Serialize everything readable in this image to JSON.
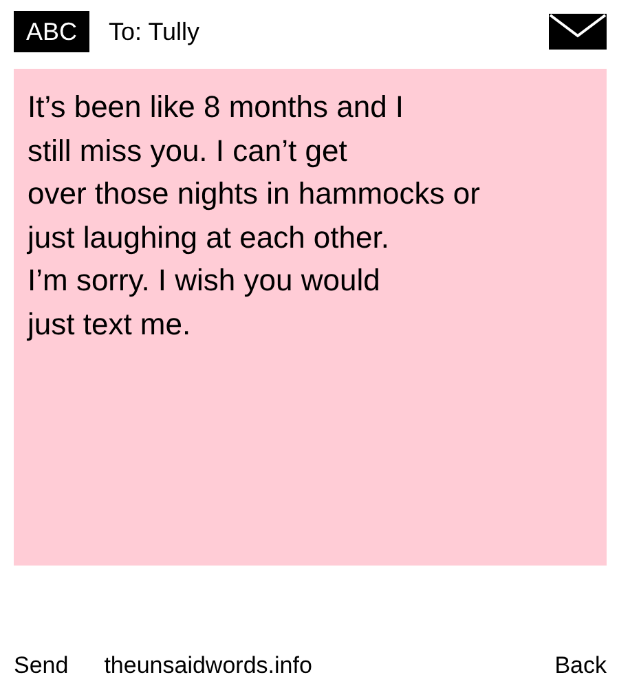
{
  "header": {
    "mode": "ABC",
    "recipient": "To: Tully"
  },
  "message": {
    "text": "It’s been like 8 months and I\nstill miss you. I can’t get\nover those nights in hammocks or\njust laughing at each other.\nI’m sorry. I wish you would\njust text me."
  },
  "footer": {
    "left": "Send",
    "center": "theunsaidwords.info",
    "right": "Back"
  }
}
